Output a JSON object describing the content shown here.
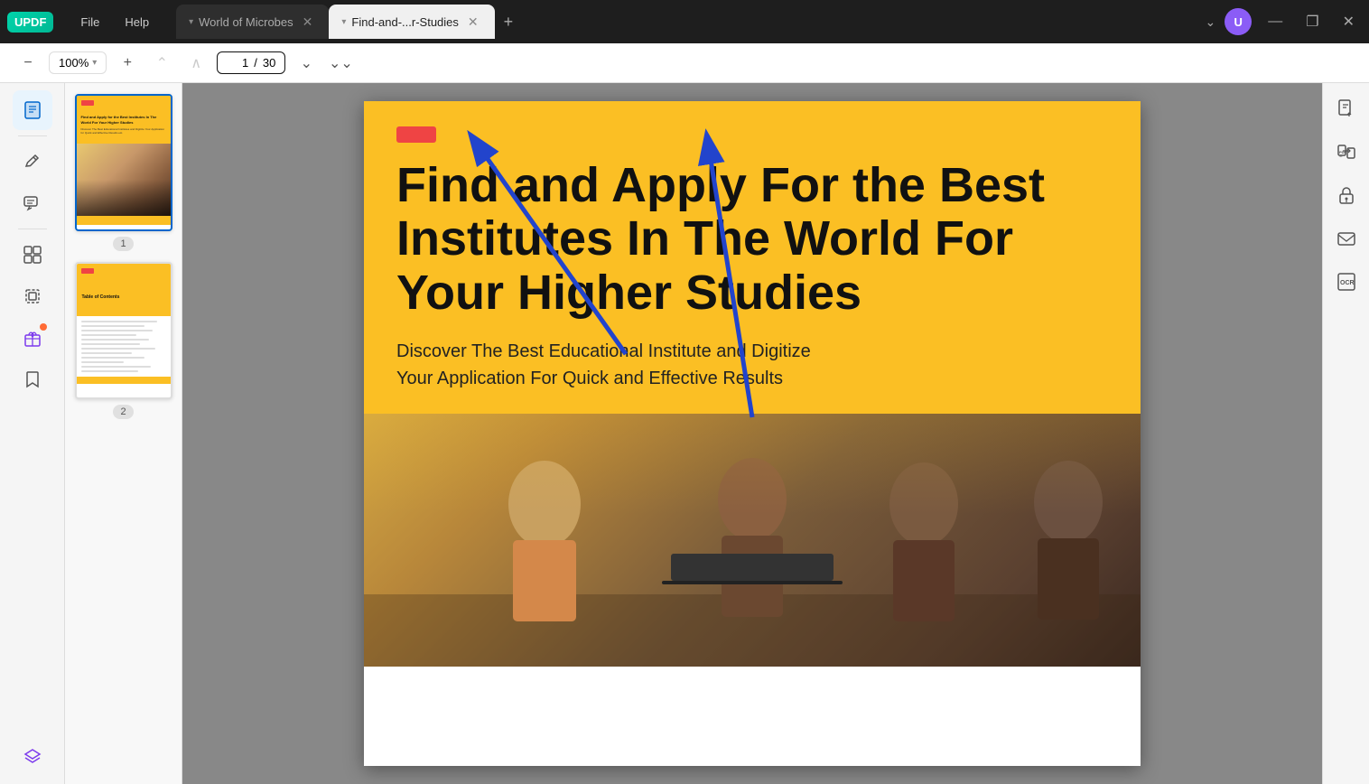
{
  "app": {
    "logo": "UPDF",
    "menu": [
      "File",
      "Help"
    ],
    "tabs": [
      {
        "id": "tab1",
        "label": "World of Microbes",
        "active": false,
        "dropdown": "▾"
      },
      {
        "id": "tab2",
        "label": "Find-and-...r-Studies",
        "active": true,
        "dropdown": "▾"
      }
    ],
    "tab_add": "+",
    "window_controls": [
      "—",
      "❐",
      "✕"
    ]
  },
  "user": {
    "avatar_letter": "U"
  },
  "toolbar": {
    "zoom_out": "−",
    "zoom_level": "100%",
    "zoom_dropdown": "▾",
    "zoom_in": "+",
    "nav_first": "⌃",
    "nav_prev": "∧",
    "page_current": "1",
    "page_separator": "/",
    "page_total": "30",
    "nav_next": "⌄",
    "nav_last": "⌄⌄"
  },
  "sidebar_left": {
    "icons": [
      {
        "name": "reader-icon",
        "symbol": "📖",
        "active": true
      },
      {
        "name": "edit-icon",
        "symbol": "✏",
        "active": false
      },
      {
        "name": "comment-icon",
        "symbol": "💬",
        "active": false
      },
      {
        "name": "organize-icon",
        "symbol": "⊞",
        "active": false
      },
      {
        "name": "crop-icon",
        "symbol": "⊡",
        "active": false
      },
      {
        "name": "gift-icon",
        "symbol": "🎁",
        "active": false,
        "badge": true
      },
      {
        "name": "bookmark-icon",
        "symbol": "🔖",
        "active": false
      },
      {
        "name": "layers-icon",
        "symbol": "◈",
        "active": false
      }
    ]
  },
  "sidebar_right": {
    "icons": [
      {
        "name": "extract-icon",
        "symbol": "⎙"
      },
      {
        "name": "pdf-convert-icon",
        "symbol": "⇄"
      },
      {
        "name": "lock-icon",
        "symbol": "🔒"
      },
      {
        "name": "mail-icon",
        "symbol": "✉"
      },
      {
        "name": "ocr-icon",
        "symbol": "⊞"
      }
    ]
  },
  "pdf": {
    "page1_title": "Find and Apply For the Best Institutes In The World For Your Higher Studies",
    "page1_subtitle": "Discover The Best Educational Institute and Digitize Your Application For Quick and Effective Results",
    "page2_title": "Table of Contents",
    "main_heading": "Find and Apply For the Best Institutes In The World For Your Higher Studies",
    "main_subtitle": "Discover The Best Educational Institute and Digitize\nYour Application For Quick and Effective Results",
    "page_num_1": "1",
    "page_num_2": "2"
  },
  "colors": {
    "yellow": "#fbbf24",
    "dark": "#111111",
    "accent_blue": "#2244cc",
    "tab_active_bg": "#f0f0f0"
  }
}
